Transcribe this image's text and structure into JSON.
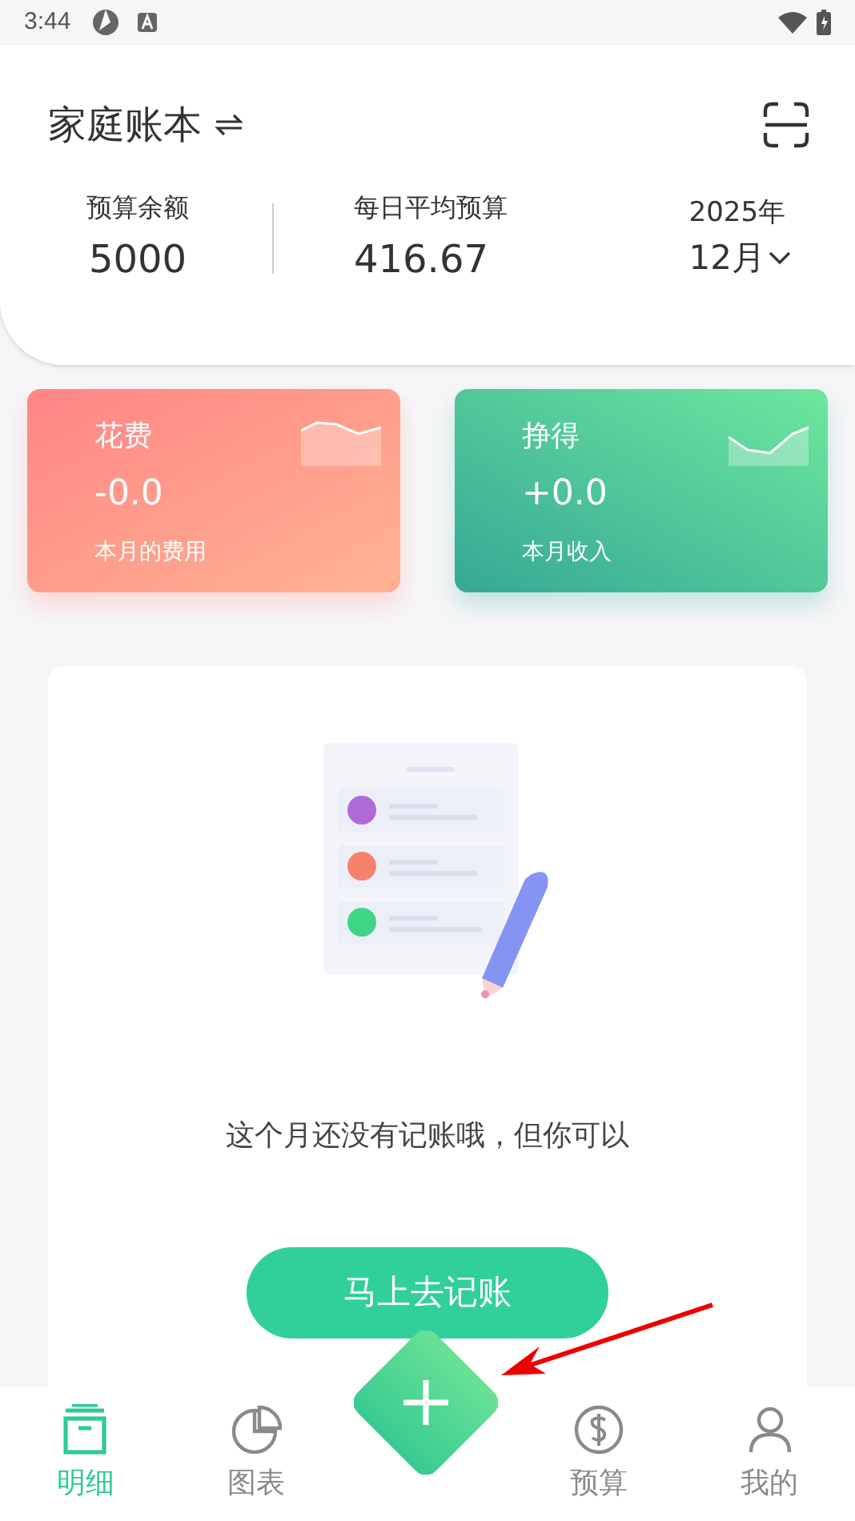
{
  "status_bar": {
    "time": "3:44"
  },
  "header": {
    "book_title": "家庭账本",
    "stats": [
      {
        "label": "预算余额",
        "value": "5000"
      },
      {
        "label": "每日平均预算",
        "value": "416.67"
      }
    ],
    "year": "2025年",
    "month": "12月"
  },
  "summary_cards": [
    {
      "kind": "expense",
      "title": "花费",
      "amount": "-0.0",
      "caption": "本月的费用"
    },
    {
      "kind": "income",
      "title": "挣得",
      "amount": "+0.0",
      "caption": "本月收入"
    }
  ],
  "empty_state": {
    "message": "这个月还没有记账哦，但你可以",
    "button": "马上去记账"
  },
  "bottom_nav": [
    {
      "label": "明细",
      "kind": "box",
      "selected": true
    },
    {
      "label": "图表",
      "kind": "pie",
      "selected": false
    },
    {
      "label": "预算",
      "kind": "coin",
      "selected": false
    },
    {
      "label": "我的",
      "kind": "person",
      "selected": false
    }
  ]
}
